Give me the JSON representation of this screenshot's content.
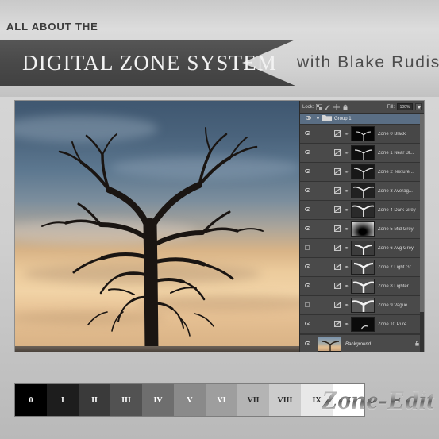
{
  "header": {
    "kicker": "ALL ABOUT THE",
    "title": "DIGITAL ZONE SYSTEM",
    "presenter": "with  Blake  Rudis"
  },
  "panel": {
    "lock_label": "Lock:",
    "lock_icons": [
      "transparency-icon",
      "brush-icon",
      "move-icon",
      "lock-icon"
    ],
    "fill_label": "Fill:",
    "fill_value": "100%",
    "group": {
      "name": "Group 1",
      "expanded": true,
      "visible": true
    },
    "layers": [
      {
        "name": "Zone 0 Black",
        "visible": true
      },
      {
        "name": "Zone 1 Near Bl...",
        "visible": true
      },
      {
        "name": "Zone 2 Texture...",
        "visible": true
      },
      {
        "name": "Zone 3 Averag...",
        "visible": true
      },
      {
        "name": "Zone 4 Dark Grey",
        "visible": true
      },
      {
        "name": "Zone 5 Mid Grey",
        "visible": true
      },
      {
        "name": "Zone 6 Avg Grey",
        "visible": false
      },
      {
        "name": "Zone 7 Light Gr...",
        "visible": true
      },
      {
        "name": "Zone 8 Lighter ...",
        "visible": true
      },
      {
        "name": "Zone 9 Vague ...",
        "visible": false
      },
      {
        "name": "Zone 10 Pure ...",
        "visible": true
      }
    ],
    "background": {
      "name": "Background",
      "visible": true,
      "locked": true
    }
  },
  "zone_strip": {
    "swatches": [
      {
        "label": "0",
        "color": "#000000",
        "text_color": "#ffffff"
      },
      {
        "label": "I",
        "color": "#1d1d1d",
        "text_color": "#ffffff"
      },
      {
        "label": "II",
        "color": "#3a3a3a",
        "text_color": "#ffffff"
      },
      {
        "label": "III",
        "color": "#525252",
        "text_color": "#ffffff"
      },
      {
        "label": "IV",
        "color": "#6e6e6e",
        "text_color": "#ffffff"
      },
      {
        "label": "V",
        "color": "#8a8a8a",
        "text_color": "#ffffff"
      },
      {
        "label": "VI",
        "color": "#9e9e9e",
        "text_color": "#ffffff"
      },
      {
        "label": "VII",
        "color": "#b4b4b4",
        "text_color": "#2a2a2a"
      },
      {
        "label": "VIII",
        "color": "#cccccc",
        "text_color": "#2a2a2a"
      },
      {
        "label": "IX",
        "color": "#e8e8e8",
        "text_color": "#2a2a2a"
      },
      {
        "label": "X",
        "color": "#ffffff",
        "text_color": "#2a2a2a"
      }
    ]
  },
  "logo": {
    "text": "Zone-Edit"
  },
  "photo": {
    "description": "Silhouetted bare tree against blue-to-golden sunset sky"
  }
}
